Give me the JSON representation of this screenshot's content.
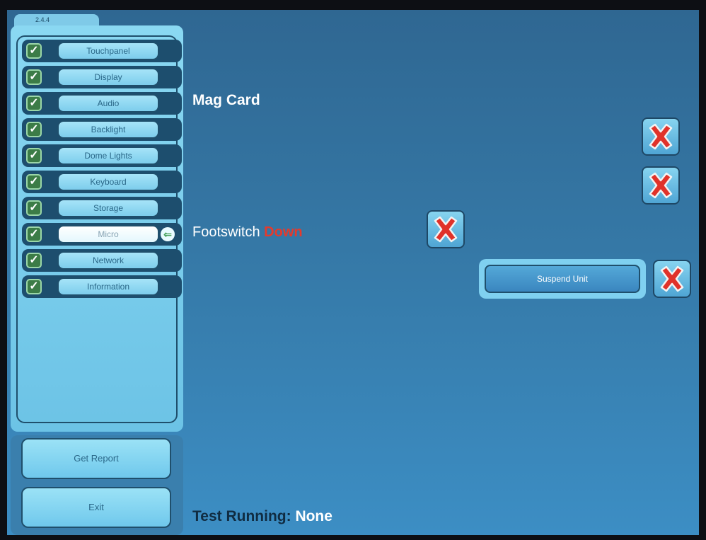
{
  "version": "2.4.4",
  "nav_items": [
    {
      "label": "Touchpanel",
      "checked": true,
      "active": false
    },
    {
      "label": "Display",
      "checked": true,
      "active": false
    },
    {
      "label": "Audio",
      "checked": true,
      "active": false
    },
    {
      "label": "Backlight",
      "checked": true,
      "active": false
    },
    {
      "label": "Dome Lights",
      "checked": true,
      "active": false
    },
    {
      "label": "Keyboard",
      "checked": true,
      "active": false
    },
    {
      "label": "Storage",
      "checked": true,
      "active": false
    },
    {
      "label": "Micro",
      "checked": true,
      "active": true
    },
    {
      "label": "Network",
      "checked": true,
      "active": false
    },
    {
      "label": "Information",
      "checked": true,
      "active": false
    }
  ],
  "buttons": {
    "get_report": "Get Report",
    "exit": "Exit",
    "suspend": "Suspend Unit"
  },
  "main": {
    "title": "Mag Card",
    "footswitch_label": "Footswitch",
    "footswitch_state": "Down"
  },
  "status": {
    "label": "Test Running:",
    "value": "None"
  },
  "icons": {
    "check": "checkmark-icon",
    "arrow": "arrow-left-icon",
    "fail": "red-x-icon"
  },
  "colors": {
    "background": "#3578a6",
    "panel": "#7fcae8",
    "check": "#3c7c47",
    "fail_red": "#e53a2c"
  }
}
